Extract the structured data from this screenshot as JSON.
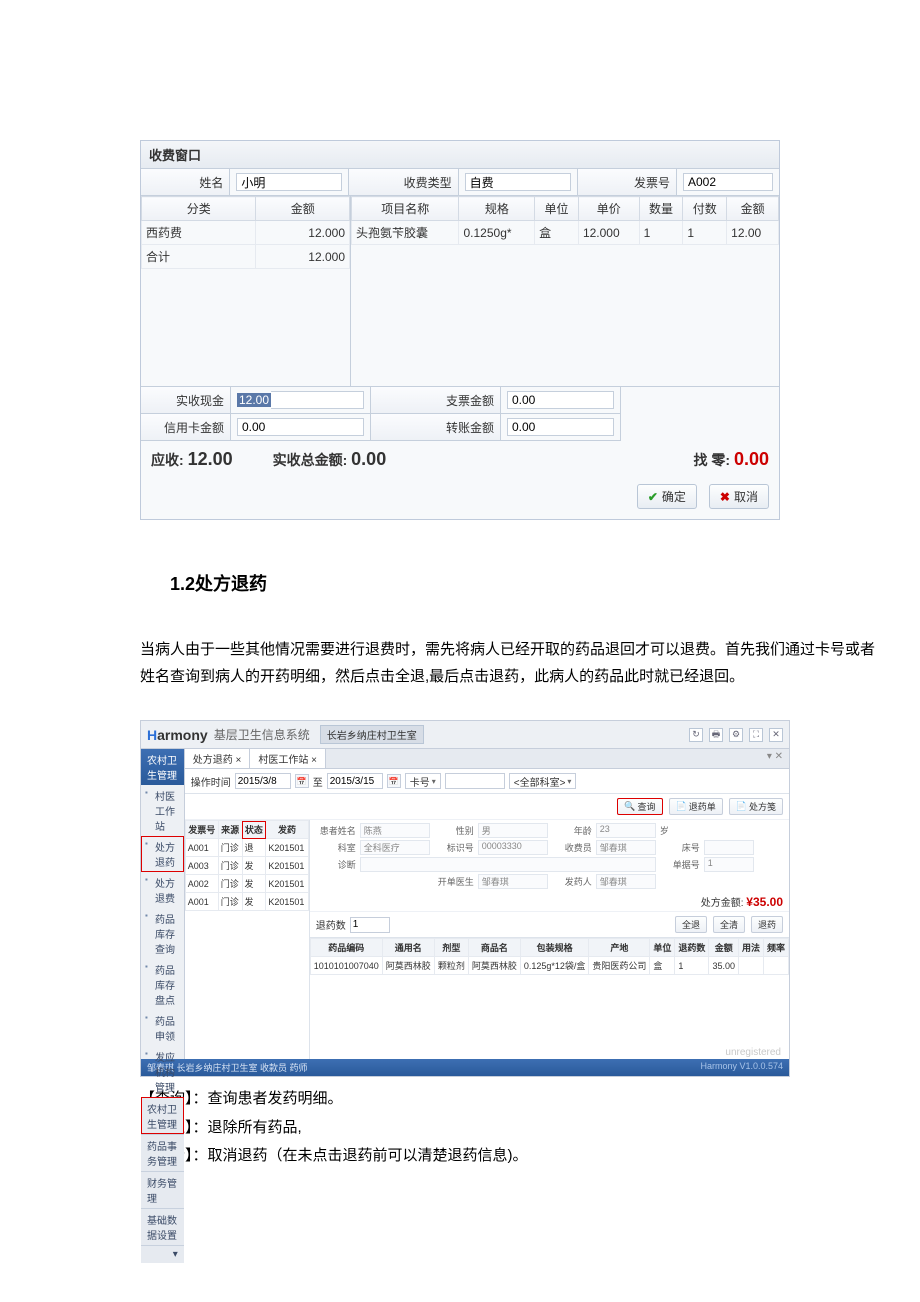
{
  "shot1": {
    "title": "收费窗口",
    "labels": {
      "name": "姓名",
      "chargeType": "收费类型",
      "invoice": "发票号"
    },
    "values": {
      "name": "小明",
      "chargeType": "自费",
      "invoice": "A002"
    },
    "leftHeaders": {
      "category": "分类",
      "amount": "金额"
    },
    "leftRows": [
      {
        "category": "西药费",
        "amount": "12.000"
      },
      {
        "category": "合计",
        "amount": "12.000"
      }
    ],
    "rightHeaders": {
      "itemName": "项目名称",
      "spec": "规格",
      "unit": "单位",
      "price": "单价",
      "qty": "数量",
      "pay": "付数",
      "amount": "金额"
    },
    "rightRows": [
      {
        "itemName": "头孢氨苄胶囊",
        "spec": "0.1250g*",
        "unit": "盒",
        "price": "12.000",
        "qty": "1",
        "pay": "1",
        "amount": "12.00"
      }
    ],
    "payLabels": {
      "cash": "实收现金",
      "cheque": "支票金额",
      "card": "信用卡金额",
      "transfer": "转账金额"
    },
    "payValues": {
      "cash": "12.00",
      "cheque": "0.00",
      "card": "0.00",
      "transfer": "0.00"
    },
    "totals": {
      "dueLabel": "应收:",
      "due": "12.00",
      "actualLabel": "实收总金额:",
      "actual": "0.00",
      "changeLabel": "找 零:",
      "change": "0.00"
    },
    "buttons": {
      "ok": "确定",
      "cancel": "取消"
    }
  },
  "docHeading": "1.2处方退药",
  "docPara": "当病人由于一些其他情况需要进行退费时，需先将病人已经开取的药品退回才可以退费。首先我们通过卡号或者姓名查询到病人的开药明细，然后点击全退,最后点击退药，此病人的药品此时就已经退回。",
  "shot2": {
    "system": "基层卫生信息系统",
    "crumb": "长岩乡纳庄村卫生室",
    "sidebar": {
      "head": "农村卫生管理",
      "items": [
        "村医工作站",
        "处方退药",
        "处方退费",
        "药品库存查询",
        "药品库存盘点",
        "药品申领",
        "发应机构管理"
      ],
      "bottom": [
        "农村卫生管理",
        "药品事务管理",
        "财务管理",
        "基础数据设置"
      ]
    },
    "tabs": [
      "处方退药 ×",
      "村医工作站 ×"
    ],
    "filter": {
      "opTimeLabel": "操作时间",
      "from": "2015/3/8",
      "to": "2015/3/15",
      "toLabel": "至",
      "keyType": "卡号",
      "scope": "<全部科室>"
    },
    "btns": {
      "query": "查询",
      "returnList": "退药单",
      "rxNote": "处方笺",
      "allReturn": "全退",
      "allClear": "全清",
      "doReturn": "退药"
    },
    "leftCols": [
      "发票号",
      "来源",
      "状态",
      "发药"
    ],
    "leftRows": [
      [
        "A001",
        "门诊",
        "退",
        "K201501"
      ],
      [
        "A003",
        "门诊",
        "发",
        "K201501"
      ],
      [
        "A002",
        "门诊",
        "发",
        "K201501"
      ],
      [
        "A001",
        "门诊",
        "发",
        "K201501"
      ]
    ],
    "info": {
      "patientLabel": "患者姓名",
      "patient": "陈燕",
      "sexLabel": "性别",
      "sex": "男",
      "ageLabel": "年龄",
      "age": "23",
      "ageUnit": "岁",
      "deptLabel": "科室",
      "dept": "全科医疗",
      "idLabel": "标识号",
      "id": "00003330",
      "diagLabel": "诊断",
      "diag": "",
      "orderDocLabel": "开单医生",
      "orderDoc": "邹春琪",
      "dispLabel": "发药人",
      "disp": "邹春琪",
      "payerLabel": "收费员",
      "payer": "邹春琪",
      "bedLabel": "床号",
      "bed": "",
      "billNoLabel": "单据号",
      "billNo": "1",
      "rxAmtLabel": "处方金额:",
      "rxAmt": "¥35.00",
      "returnQtyLabel": "退药数",
      "returnQty": "1"
    },
    "medCols": [
      "药品编码",
      "通用名",
      "剂型",
      "商品名",
      "包装规格",
      "产地",
      "单位",
      "退药数",
      "金额",
      "用法",
      "频率"
    ],
    "medRows": [
      [
        "1010101007040",
        "阿莫西林胶",
        "颗粒剂",
        "阿莫西林胶",
        "0.125g*12袋/盒",
        "贵阳医药公司",
        "盒",
        "1",
        "35.00",
        "",
        ""
      ]
    ],
    "status": "邹春琪  长岩乡纳庄村卫生室  收款员  药师",
    "version": "Harmony V1.0.0.574",
    "unreg": "unregistered"
  },
  "legend": {
    "query": "【查询】：查询患者发药明细。",
    "allReturn": "【全退】：退除所有药品,",
    "allClear": "【全清】：取消退药（在未点击退药前可以清楚退药信息)。"
  }
}
